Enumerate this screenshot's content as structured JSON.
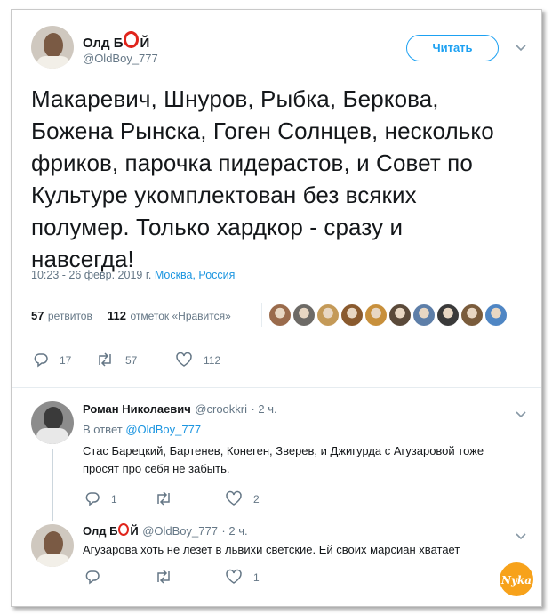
{
  "main_tweet": {
    "author_name_pre": "Олд Б",
    "author_name_post": "Й",
    "handle": "@OldBoy_777",
    "follow_label": "Читать",
    "text_lines": [
      "Макаревич, Шнуров, Рыбка, Беркова,",
      "Божена Рынска, Гоген Солнцев, несколько",
      "фриков, парочка пидерастов, и Совет по",
      "Культуре укомплектован без всяких",
      "полумер. Только хардкор - сразу и",
      "навсегда!"
    ],
    "timestamp": "10:23 - 26 февр. 2019 г.",
    "location": "Москва, Россия",
    "retweets_count": "57",
    "retweets_label": "ретвитов",
    "likes_count": "112",
    "likes_label": "отметок «Нравится»",
    "actions": {
      "replies": "17",
      "retweets": "57",
      "likes": "112"
    }
  },
  "liker_avatar_colors": [
    "#9a6b4c",
    "#6d6a66",
    "#c49a58",
    "#8a5a2e",
    "#c8903c",
    "#5b4a3a",
    "#5d7ea8",
    "#3a3a3a",
    "#7a5c3c",
    "#4f86c4"
  ],
  "replies": [
    {
      "author_name": "Роман Николаевич",
      "handle": "@crookkri",
      "time": "· 2 ч.",
      "reply_to_label": "В ответ",
      "reply_to_handle": "@OldBoy_777",
      "text_lines": [
        "Стас Барецкий, Бартенев, Конеген, Зверев, и Джигурда с Агузаровой тоже",
        "просят про себя не забыть."
      ],
      "actions": {
        "replies": "1",
        "retweets": "",
        "likes": "2"
      }
    },
    {
      "author_name_pre": "Олд Б",
      "author_name_post": "Й",
      "handle": "@OldBoy_777",
      "time": "· 2 ч.",
      "text_lines": [
        "Агузарова хоть не лезет в львихи светские. Ей своих марсиан хватает"
      ],
      "actions": {
        "replies": "",
        "retweets": "",
        "likes": "1"
      }
    }
  ],
  "watermark": "Nyka",
  "colors": {
    "accent": "#1da1f2",
    "link": "#1b95e0",
    "muted": "#657786",
    "brand_o": "#e0241b"
  }
}
